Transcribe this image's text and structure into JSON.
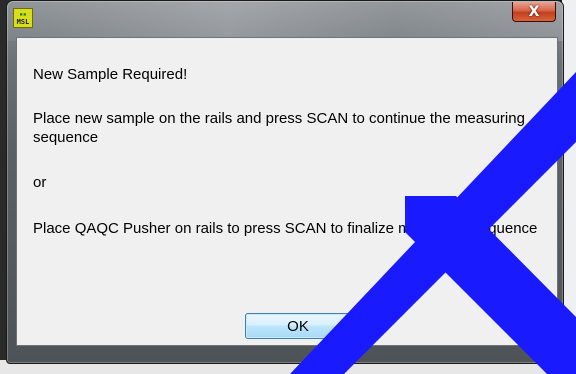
{
  "window": {
    "app_icon_top": "MSL",
    "app_icon_label": "MSL",
    "close_label": "X"
  },
  "dialog": {
    "line1": "New Sample Required!",
    "line2": "Place new sample on the rails and press SCAN to continue the measuring sequence",
    "line3": "or",
    "line4": "Place QAQC Pusher on rails to press SCAN to finalize measuring sequence",
    "ok_label": "OK"
  },
  "colors": {
    "overlay_chevron": "#1a1aff",
    "client_background": "#f0f0f0",
    "close_button": "#c94a2a"
  },
  "icons": [
    "msl-app-icon",
    "close-icon"
  ]
}
